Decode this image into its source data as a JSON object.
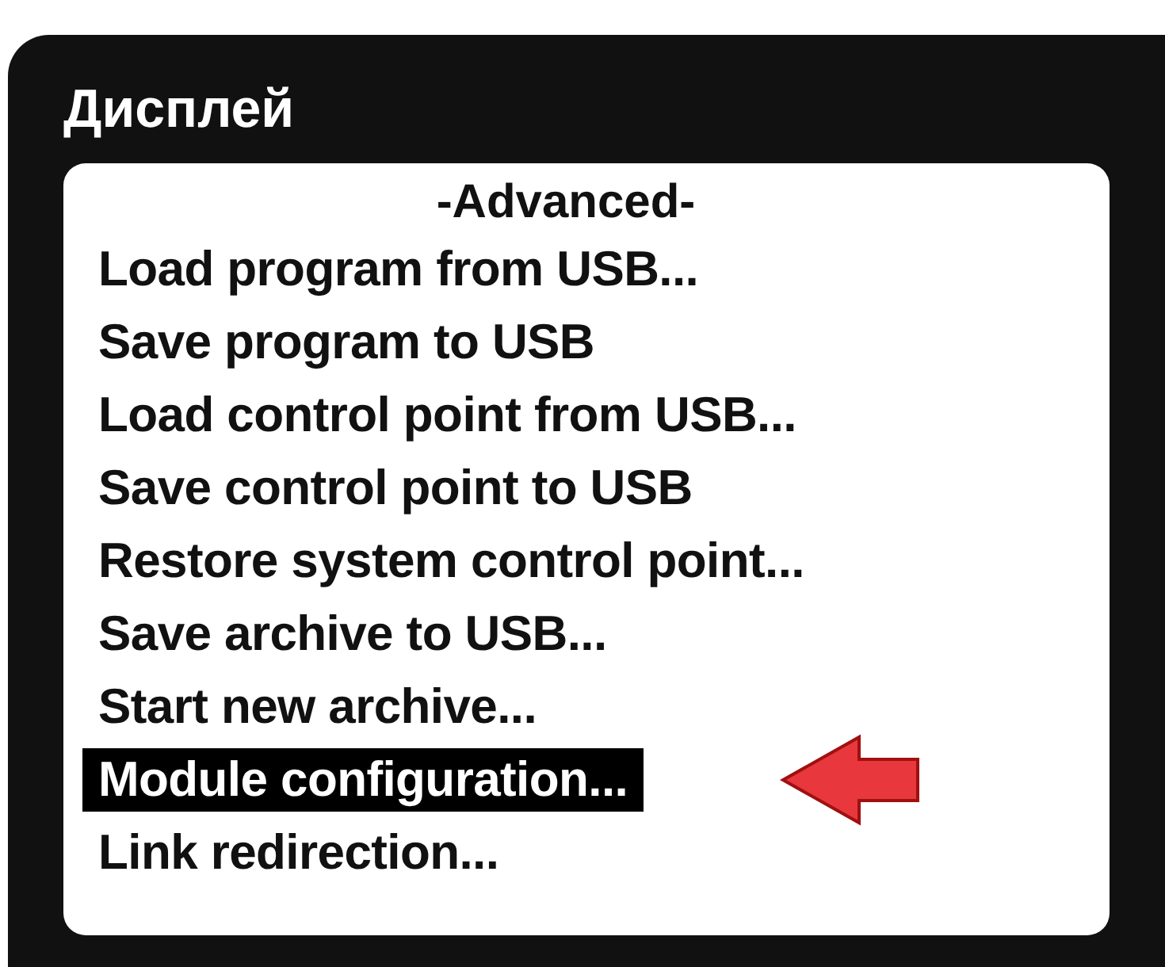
{
  "screen": {
    "title": "Дисплей"
  },
  "menu": {
    "heading": "-Advanced-",
    "items": [
      {
        "label": "Load program from USB...",
        "selected": false
      },
      {
        "label": "Save program to USB",
        "selected": false
      },
      {
        "label": "Load control point from USB...",
        "selected": false
      },
      {
        "label": "Save control point to USB",
        "selected": false
      },
      {
        "label": "Restore system control point...",
        "selected": false
      },
      {
        "label": "Save archive to USB...",
        "selected": false
      },
      {
        "label": "Start new archive...",
        "selected": false
      },
      {
        "label": "Module configuration...",
        "selected": true
      },
      {
        "label": "Link redirection...",
        "selected": false
      }
    ]
  }
}
